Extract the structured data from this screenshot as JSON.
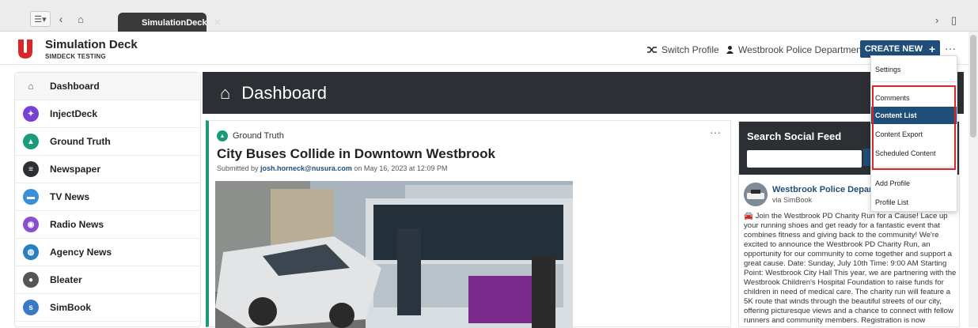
{
  "browser": {
    "tab_label": "SimulationDeck",
    "menu_glyph": "☰▾",
    "back_glyph": "‹",
    "home_glyph": "⌂",
    "close_glyph": "✕",
    "right_glyphs": [
      "›",
      "▯"
    ]
  },
  "header": {
    "title": "Simulation Deck",
    "subtitle": "SIMDECK TESTING",
    "switch_profile": "Switch Profile",
    "department": "Westbrook Police Department",
    "create_new": "CREATE NEW",
    "create_plus": "+",
    "more": "···"
  },
  "sidebar": {
    "items": [
      {
        "label": "Dashboard",
        "icon": "home-icon",
        "color": "",
        "glyph": "⌂"
      },
      {
        "label": "InjectDeck",
        "icon": "injectdeck-icon",
        "color": "#7a3fd6",
        "glyph": "✦"
      },
      {
        "label": "Ground Truth",
        "icon": "ground-truth-icon",
        "color": "#1a9b7a",
        "glyph": "▲"
      },
      {
        "label": "Newspaper",
        "icon": "newspaper-icon",
        "color": "#2c2f33",
        "glyph": "≡"
      },
      {
        "label": "TV News",
        "icon": "tv-icon",
        "color": "#3a8fd9",
        "glyph": "▬"
      },
      {
        "label": "Radio News",
        "icon": "radio-icon",
        "color": "#8a4fcf",
        "glyph": "◉"
      },
      {
        "label": "Agency News",
        "icon": "agency-icon",
        "color": "#2a7fc0",
        "glyph": "◍"
      },
      {
        "label": "Bleater",
        "icon": "bleater-icon",
        "color": "#555555",
        "glyph": "●"
      },
      {
        "label": "SimBook",
        "icon": "simbook-icon",
        "color": "#3a78c8",
        "glyph": "s"
      }
    ]
  },
  "dashboard": {
    "title": "Dashboard",
    "glyph": "⌂"
  },
  "post": {
    "tag": "Ground Truth",
    "title": "City Buses Collide in Downtown Westbrook",
    "meta_prefix": "Submitted by",
    "author": "josh.horneck@nusura.com",
    "meta_suffix": "on May 16, 2023 at 12:09 PM",
    "more": "···"
  },
  "social": {
    "title": "Search Social Feed",
    "post_name": "Westbrook Police Departme",
    "post_via": "via SimBook",
    "post_body": "Join the Westbrook PD Charity Run for a Cause! Lace up your running shoes and get ready for a fantastic event that combines fitness and giving back to the community! We're excited to announce the Westbrook PD Charity Run, an opportunity for our community to come together and support a great cause. Date: Sunday, July 10th Time: 9:00 AM Starting Point: Westbrook City Hall This year, we are partnering with the Westbrook Children's Hospital Foundation to raise funds for children in need of medical care. The charity run will feature a 5K route that winds through the beautiful streets of our city, offering picturesque views and a chance to connect with fellow runners and community members. Registration is now"
  },
  "menu": {
    "items": [
      {
        "label": "Settings"
      },
      {
        "label": "Comments"
      },
      {
        "label": "Content List"
      },
      {
        "label": "Content Export"
      },
      {
        "label": "Scheduled Content"
      },
      {
        "label": "Add Profile"
      },
      {
        "label": "Profile List"
      }
    ],
    "active_index": 2
  },
  "colors": {
    "brand": "#1f4e79",
    "highlight": "#d9262a",
    "dark": "#2c2f33",
    "ground_truth": "#1a9b7a"
  }
}
